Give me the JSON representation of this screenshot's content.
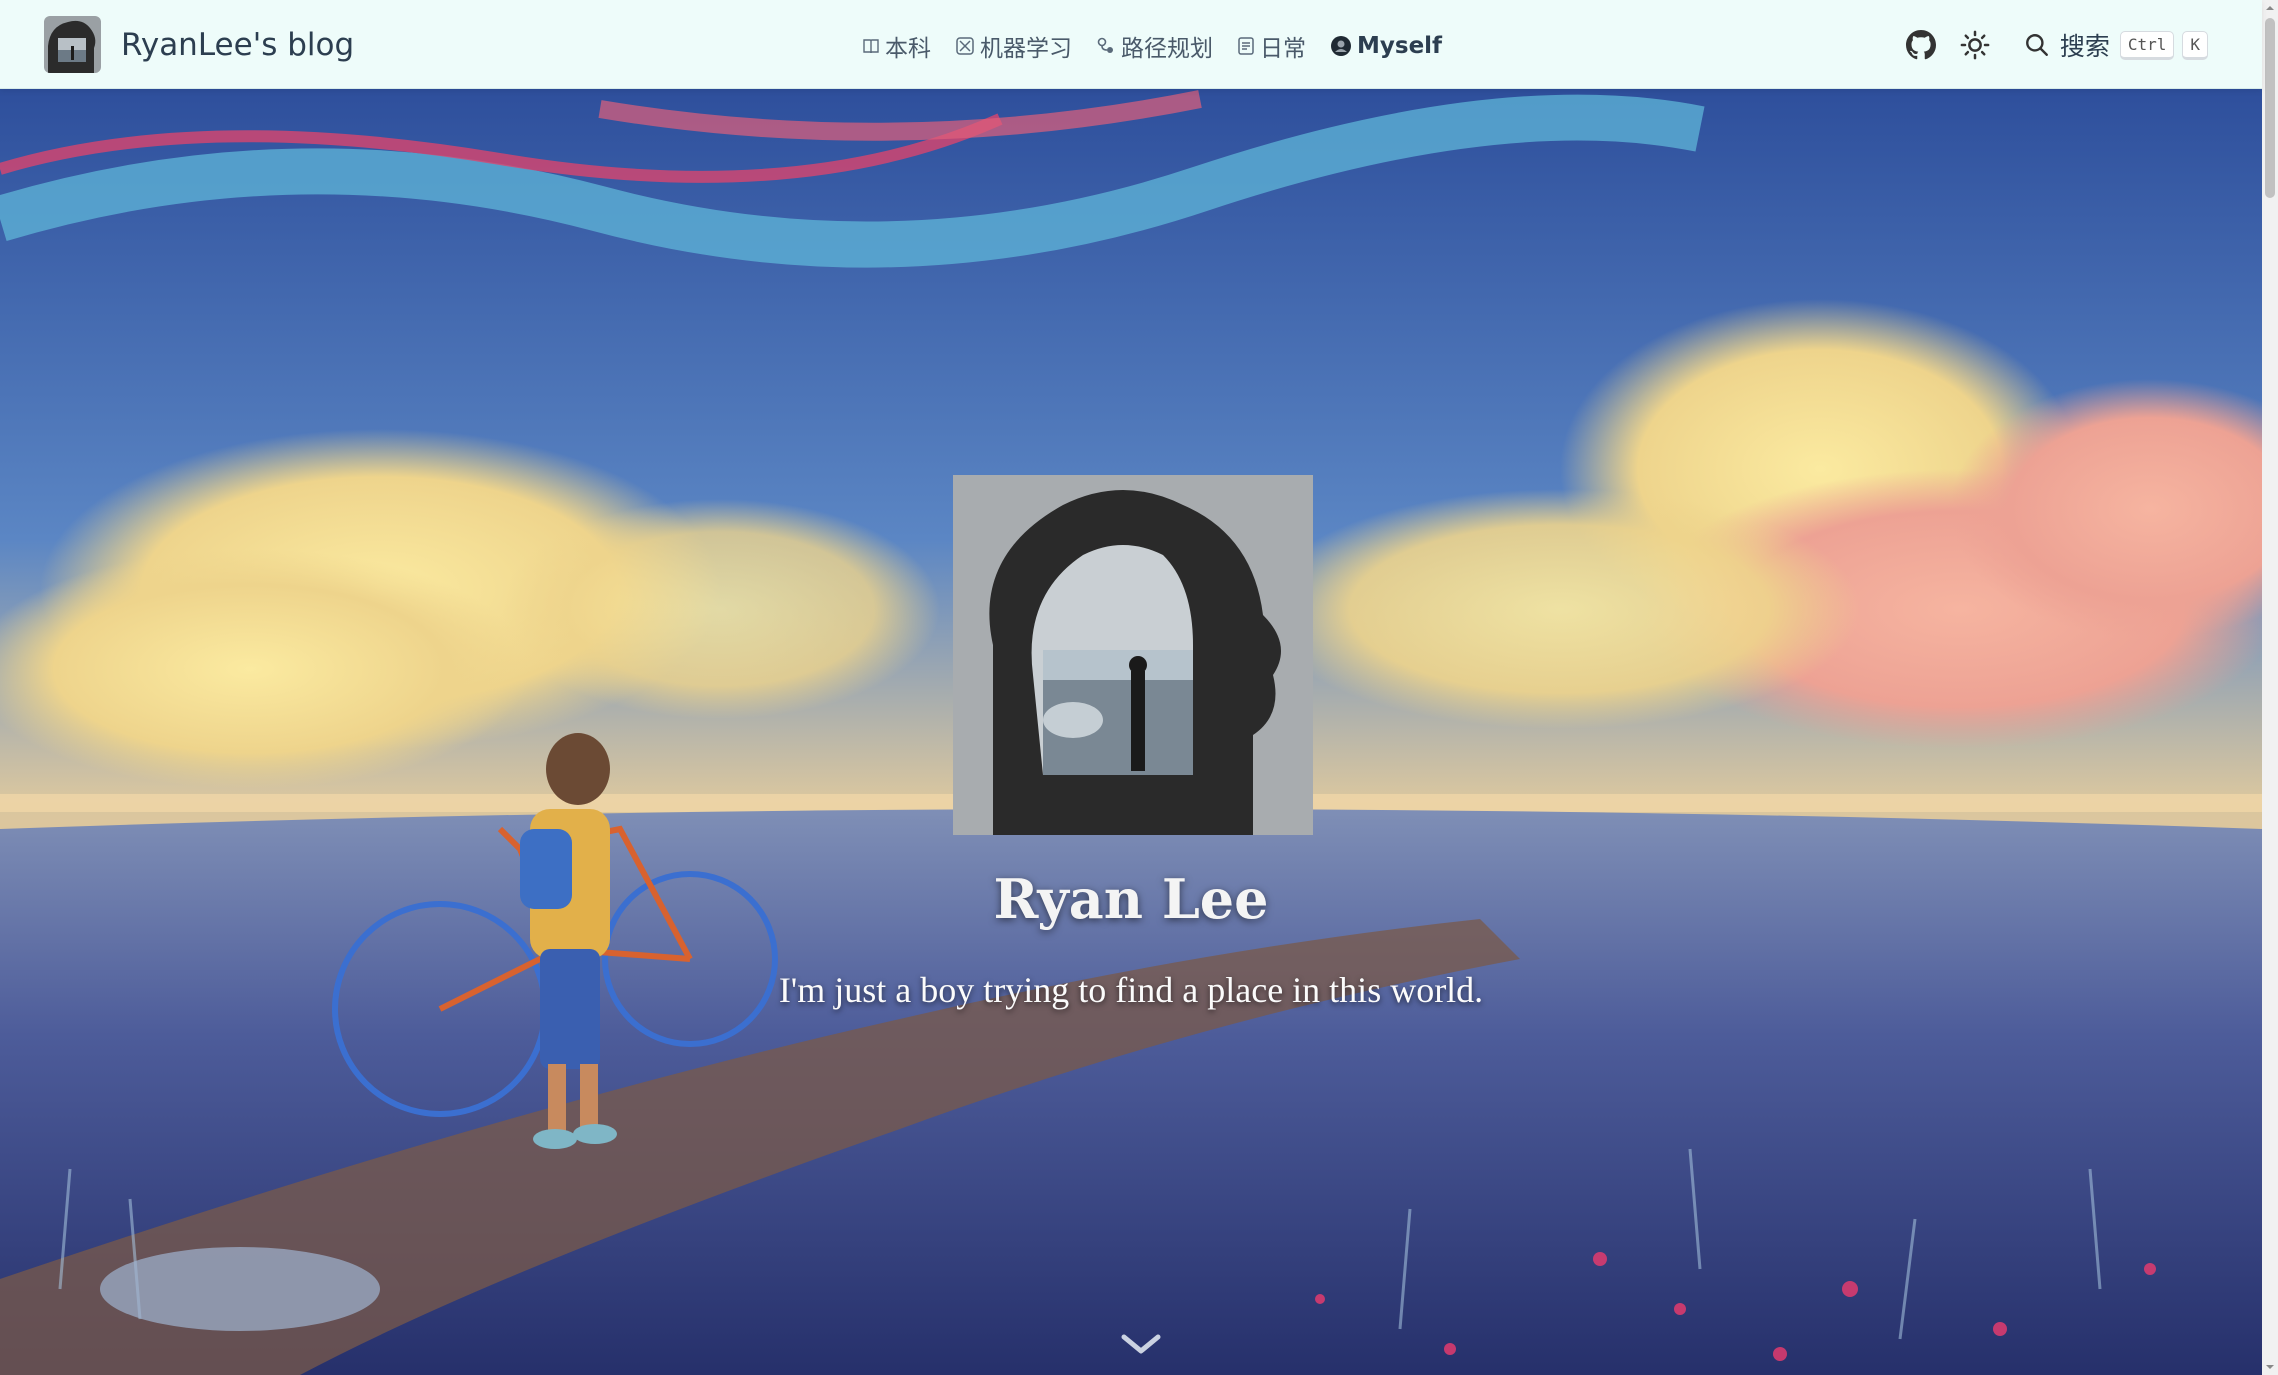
{
  "brand": {
    "name": "RyanLee's blog",
    "logo_icon": "avatar-logo-icon"
  },
  "nav": {
    "items": [
      {
        "label": "本科",
        "icon": "book-icon"
      },
      {
        "label": "机器学习",
        "icon": "ml-icon"
      },
      {
        "label": "路径规划",
        "icon": "route-icon"
      },
      {
        "label": "日常",
        "icon": "note-icon"
      },
      {
        "label": "Myself",
        "icon": "profile-icon"
      }
    ]
  },
  "toolbar": {
    "github_icon": "github-icon",
    "theme_icon": "sun-icon",
    "search_label": "搜索",
    "search_key_1": "Ctrl",
    "search_key_2": "K"
  },
  "hero": {
    "name": "Ryan Lee",
    "tagline": "I'm just a boy trying to find a place in this world.",
    "scroll_icon": "chevron-down-icon"
  },
  "colors": {
    "navbar_bg": "#eefcfa",
    "text": "#2c3e50"
  }
}
